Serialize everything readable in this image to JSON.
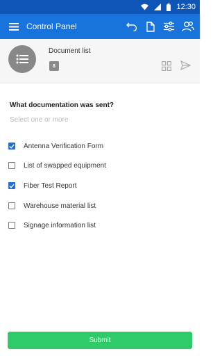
{
  "status_bar": {
    "time": "12:30"
  },
  "app_bar": {
    "title": "Control Panel",
    "actions": [
      "undo-icon",
      "document-icon",
      "sliders-icon",
      "people-icon"
    ]
  },
  "header": {
    "title": "Document list",
    "count": "8",
    "avatar_icon": "list-icon"
  },
  "form": {
    "question": "What documentation was sent?",
    "hint": "Select one or more",
    "options": [
      {
        "label": "Antenna Verification Form",
        "checked": true
      },
      {
        "label": "List of swapped equipment",
        "checked": false
      },
      {
        "label": "Fiber Test Report",
        "checked": true
      },
      {
        "label": "Warehouse material list",
        "checked": false
      },
      {
        "label": "Signage information list",
        "checked": false
      }
    ],
    "submit_label": "Submit"
  },
  "colors": {
    "status_bar": "#0f55b6",
    "app_bar": "#1873dd",
    "checkbox_checked": "#1e6fd9",
    "submit": "#2fcb6b"
  }
}
